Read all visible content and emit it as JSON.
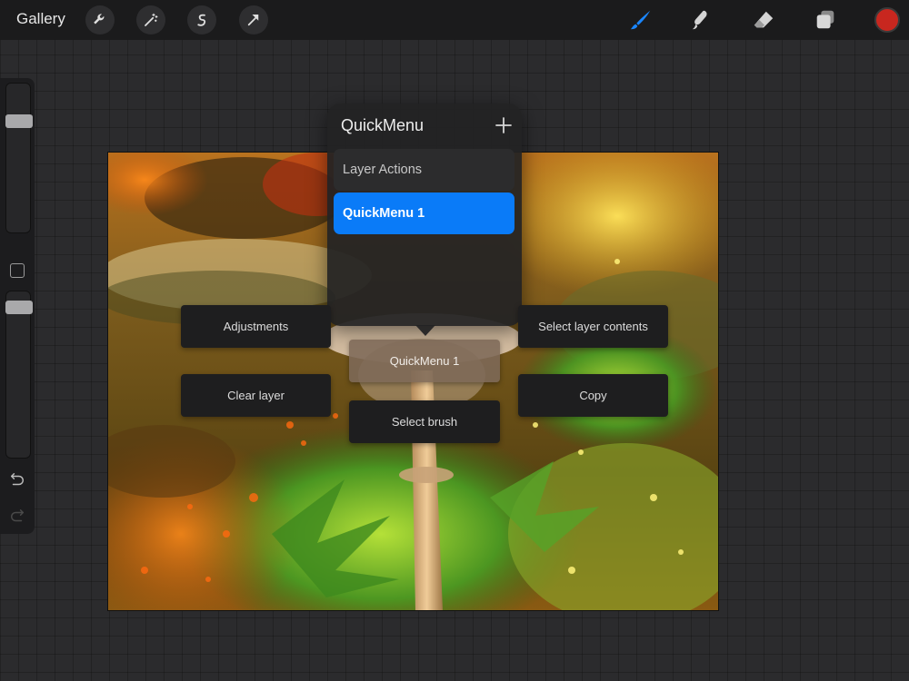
{
  "toolbar": {
    "gallery_label": "Gallery",
    "left_tools": [
      "wrench-icon",
      "magic-wand-icon",
      "selection-s-icon",
      "transform-arrow-icon"
    ],
    "right_tools": [
      "brush-icon",
      "smudge-icon",
      "eraser-icon",
      "layers-icon"
    ],
    "active_tool": "brush",
    "current_color": "#c8271f",
    "accent_color": "#0a7bf8"
  },
  "sidebar": {
    "brush_size_level": 0.77,
    "opacity_level": 0.94,
    "icons": [
      "modify-square-icon",
      "undo-icon",
      "redo-icon"
    ]
  },
  "quickmenu_panel": {
    "title": "QuickMenu",
    "add_icon": "plus-icon",
    "items": [
      {
        "label": "Layer Actions",
        "selected": false
      },
      {
        "label": "QuickMenu 1",
        "selected": true
      }
    ]
  },
  "radial_menu": {
    "center": "QuickMenu 1",
    "buttons": {
      "top_left": "Adjustments",
      "top_right": "Select layer contents",
      "bottom_left": "Clear layer",
      "bottom_right": "Copy",
      "bottom": "Select brush"
    }
  }
}
